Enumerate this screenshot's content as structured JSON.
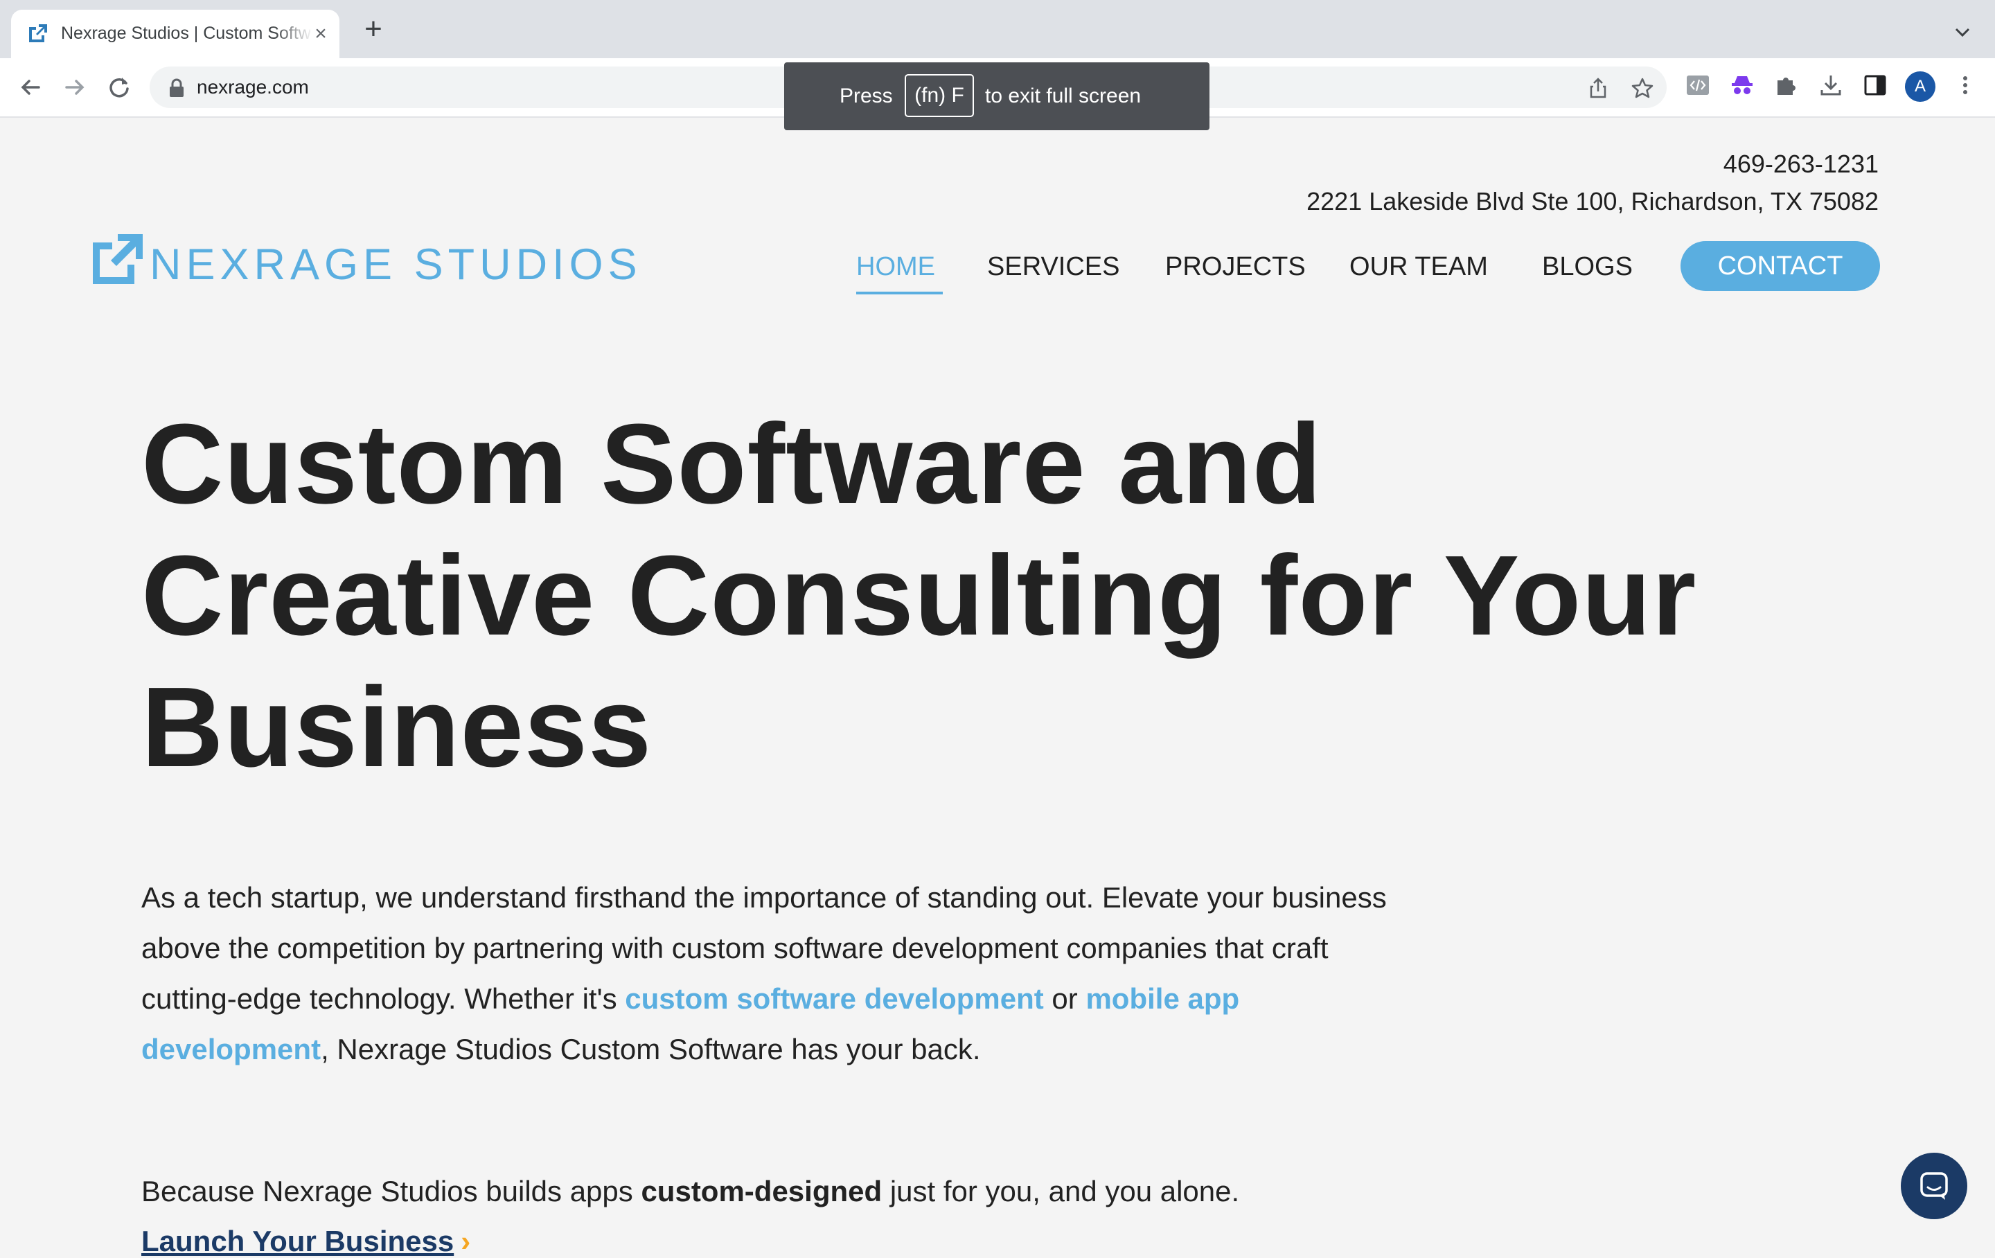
{
  "browser": {
    "tab_title": "Nexrage Studios | Custom Software and Creative Consulting",
    "tab_close": "×",
    "new_tab": "+",
    "url": "nexrage.com",
    "profile_initial": "A",
    "fullscreen_banner": {
      "press": "Press",
      "key": "(fn) F",
      "exit": "to exit full screen"
    }
  },
  "site": {
    "phone": "469-263-1231",
    "address": "2221 Lakeside Blvd Ste 100, Richardson, TX 75082",
    "logo_text": "NEXRAGE STUDIOS",
    "brand_color": "#5aaee0",
    "nav": {
      "home": "HOME",
      "services": "SERVICES",
      "projects": "PROJECTS",
      "team": "OUR TEAM",
      "blogs": "BLOGS",
      "contact": "CONTACT"
    },
    "active_nav": "HOME"
  },
  "hero": {
    "title_line1": "Custom Software and",
    "title_line2": "Creative Consulting for Your",
    "title_line3": "Business"
  },
  "intro": {
    "text_start": "As a tech startup, we understand firsthand the importance of standing out. Elevate your business above the competition by partnering with custom software development companies that craft cutting-edge technology. Whether it's ",
    "link1": "custom software development",
    "text_mid": " or ",
    "link2": "mobile app development",
    "text_end": ", Nexrage Studios Custom Software has your back."
  },
  "tagline": {
    "start": "Because Nexrage Studios builds apps ",
    "bold": "custom-designed",
    "end": " just for you, and you alone."
  },
  "cta": {
    "launch": "Launch Your Business",
    "arrow": "›"
  },
  "icons": {
    "back": "arrow-left-icon",
    "forward": "arrow-right-icon",
    "reload": "reload-icon",
    "lock": "lock-icon",
    "share": "share-icon",
    "bookmark": "star-icon",
    "chat": "chat-bubble-icon"
  }
}
